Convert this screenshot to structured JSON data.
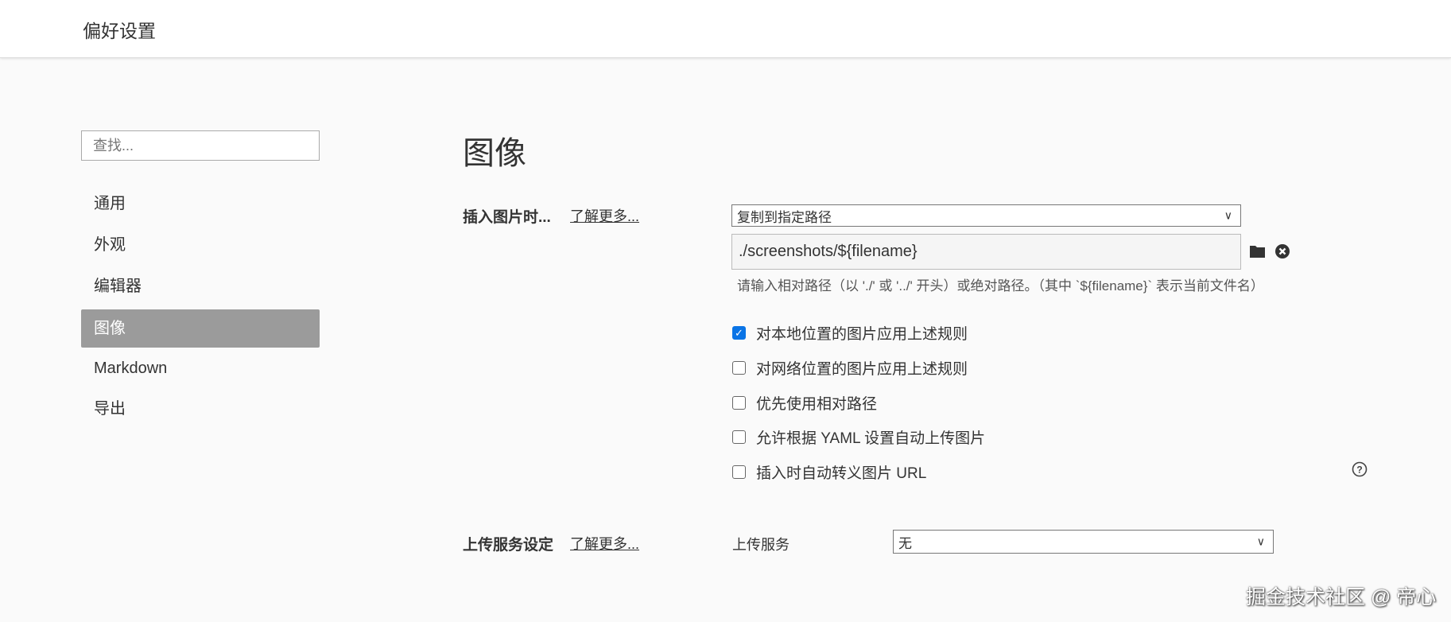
{
  "header": {
    "title": "偏好设置"
  },
  "sidebar": {
    "search_placeholder": "查找...",
    "items": [
      {
        "label": "通用"
      },
      {
        "label": "外观"
      },
      {
        "label": "编辑器"
      },
      {
        "label": "图像",
        "active": true
      },
      {
        "label": "Markdown"
      },
      {
        "label": "导出"
      }
    ]
  },
  "main": {
    "heading": "图像",
    "insert": {
      "label": "插入图片时...",
      "learn_more": "了解更多...",
      "action_selected": "复制到指定路径",
      "path_value": "./screenshots/${filename}",
      "hint": "请输入相对路径（以 './' 或 '../' 开头）或绝对路径。（其中 `${filename}` 表示当前文件名）",
      "options": [
        {
          "label": "对本地位置的图片应用上述规则",
          "checked": true
        },
        {
          "label": "对网络位置的图片应用上述规则",
          "checked": false
        },
        {
          "label": "优先使用相对路径",
          "checked": false
        },
        {
          "label": "允许根据 YAML 设置自动上传图片",
          "checked": false
        },
        {
          "label": "插入时自动转义图片 URL",
          "checked": false
        }
      ]
    },
    "upload": {
      "label": "上传服务设定",
      "learn_more": "了解更多...",
      "service_label": "上传服务",
      "service_selected": "无"
    }
  },
  "watermark": "掘金技术社区 @ 帝心",
  "colors": {
    "accent": "#0a74e6",
    "selected_nav": "#9b9b9b"
  }
}
